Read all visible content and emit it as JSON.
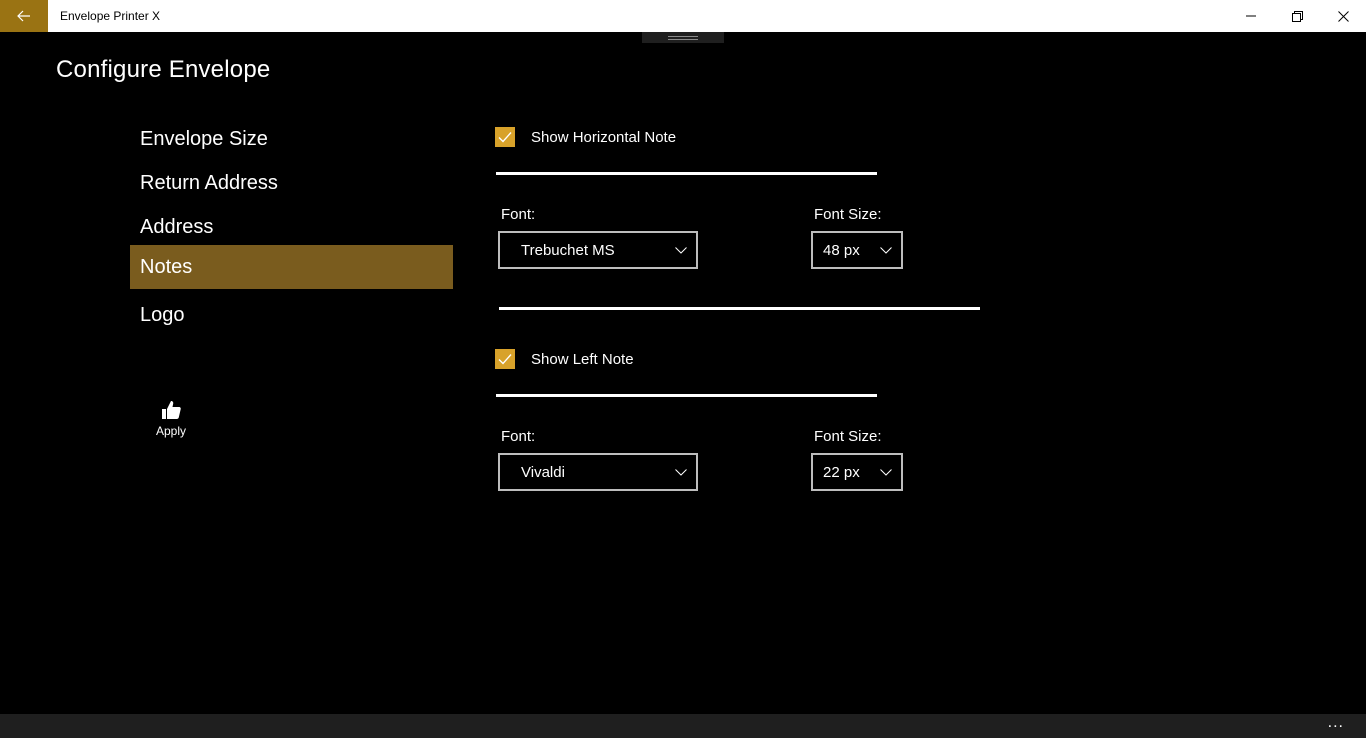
{
  "window": {
    "title": "Envelope Printer X",
    "accent": "#9a7313"
  },
  "page": {
    "title": "Configure Envelope"
  },
  "nav": {
    "items": [
      {
        "label": "Envelope Size"
      },
      {
        "label": "Return Address"
      },
      {
        "label": "Address"
      },
      {
        "label": "Notes",
        "selected": true
      },
      {
        "label": "Logo"
      }
    ],
    "selected_color": "#7a5c1e"
  },
  "apply": {
    "label": "Apply",
    "icon": "thumbs-up-icon"
  },
  "horizontal_note": {
    "checkbox_label": "Show Horizontal Note",
    "checked": true,
    "font_label": "Font:",
    "font_value": "Trebuchet MS",
    "size_label": "Font Size:",
    "size_value": "48 px"
  },
  "left_note": {
    "checkbox_label": "Show Left Note",
    "checked": true,
    "font_label": "Font:",
    "font_value": "Vivaldi",
    "size_label": "Font Size:",
    "size_value": "22 px"
  },
  "bottom_bar": {
    "more_label": "..."
  },
  "colors": {
    "checkbox": "#d8a22a",
    "background": "#000000"
  }
}
